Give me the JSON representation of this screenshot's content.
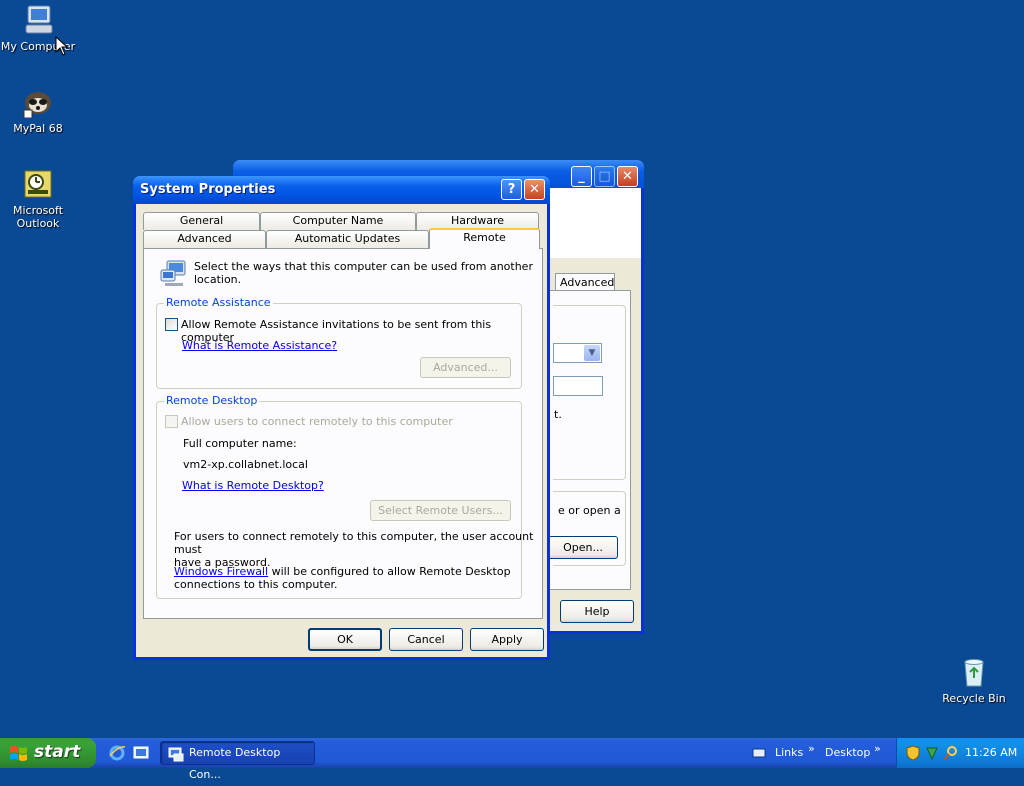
{
  "desktop": {
    "icons": [
      {
        "label": "My Computer"
      },
      {
        "label": "MyPal 68"
      },
      {
        "label": "Microsoft Outlook"
      },
      {
        "label": "Recycle Bin"
      }
    ]
  },
  "background_window": {
    "tab_advanced": "Advanced",
    "fragment_t": "t.",
    "fragment_open_text": "e or open a",
    "open_button": "Open...",
    "help_button": "Help"
  },
  "dialog": {
    "title": "System Properties",
    "help_glyph": "?",
    "close_glyph": "✕",
    "tabs_row1": [
      "General",
      "Computer Name",
      "Hardware"
    ],
    "tabs_row2": [
      "Advanced",
      "Automatic Updates",
      "Remote"
    ],
    "active_tab": "Remote",
    "intro_text_line1": "Select the ways that this computer can be used from another",
    "intro_text_line2": "location.",
    "remote_assistance": {
      "title": "Remote Assistance",
      "checkbox_label": "Allow Remote Assistance invitations to be sent from this computer",
      "checked": false,
      "link": "What is Remote Assistance?",
      "advanced_button": "Advanced..."
    },
    "remote_desktop": {
      "title": "Remote Desktop",
      "checkbox_label": "Allow users to connect remotely to this computer",
      "checked": false,
      "full_name_label": "Full computer name:",
      "full_name_value": "vm2-xp.collabnet.local",
      "link": "What is Remote Desktop?",
      "select_users_button": "Select Remote Users...",
      "info_line1": "For users to connect remotely to this computer, the user account must",
      "info_line2": "have a password.",
      "firewall_link": "Windows Firewall",
      "firewall_rest_line1": " will be configured to allow Remote Desktop",
      "firewall_line2": "connections to this computer."
    },
    "buttons": {
      "ok": "OK",
      "cancel": "Cancel",
      "apply": "Apply"
    }
  },
  "taskbar": {
    "start_label": "start",
    "task_button": "Remote Desktop Con...",
    "links_label": "Links",
    "desktop_label": "Desktop",
    "chevron": "»",
    "clock": "11:26 AM"
  }
}
